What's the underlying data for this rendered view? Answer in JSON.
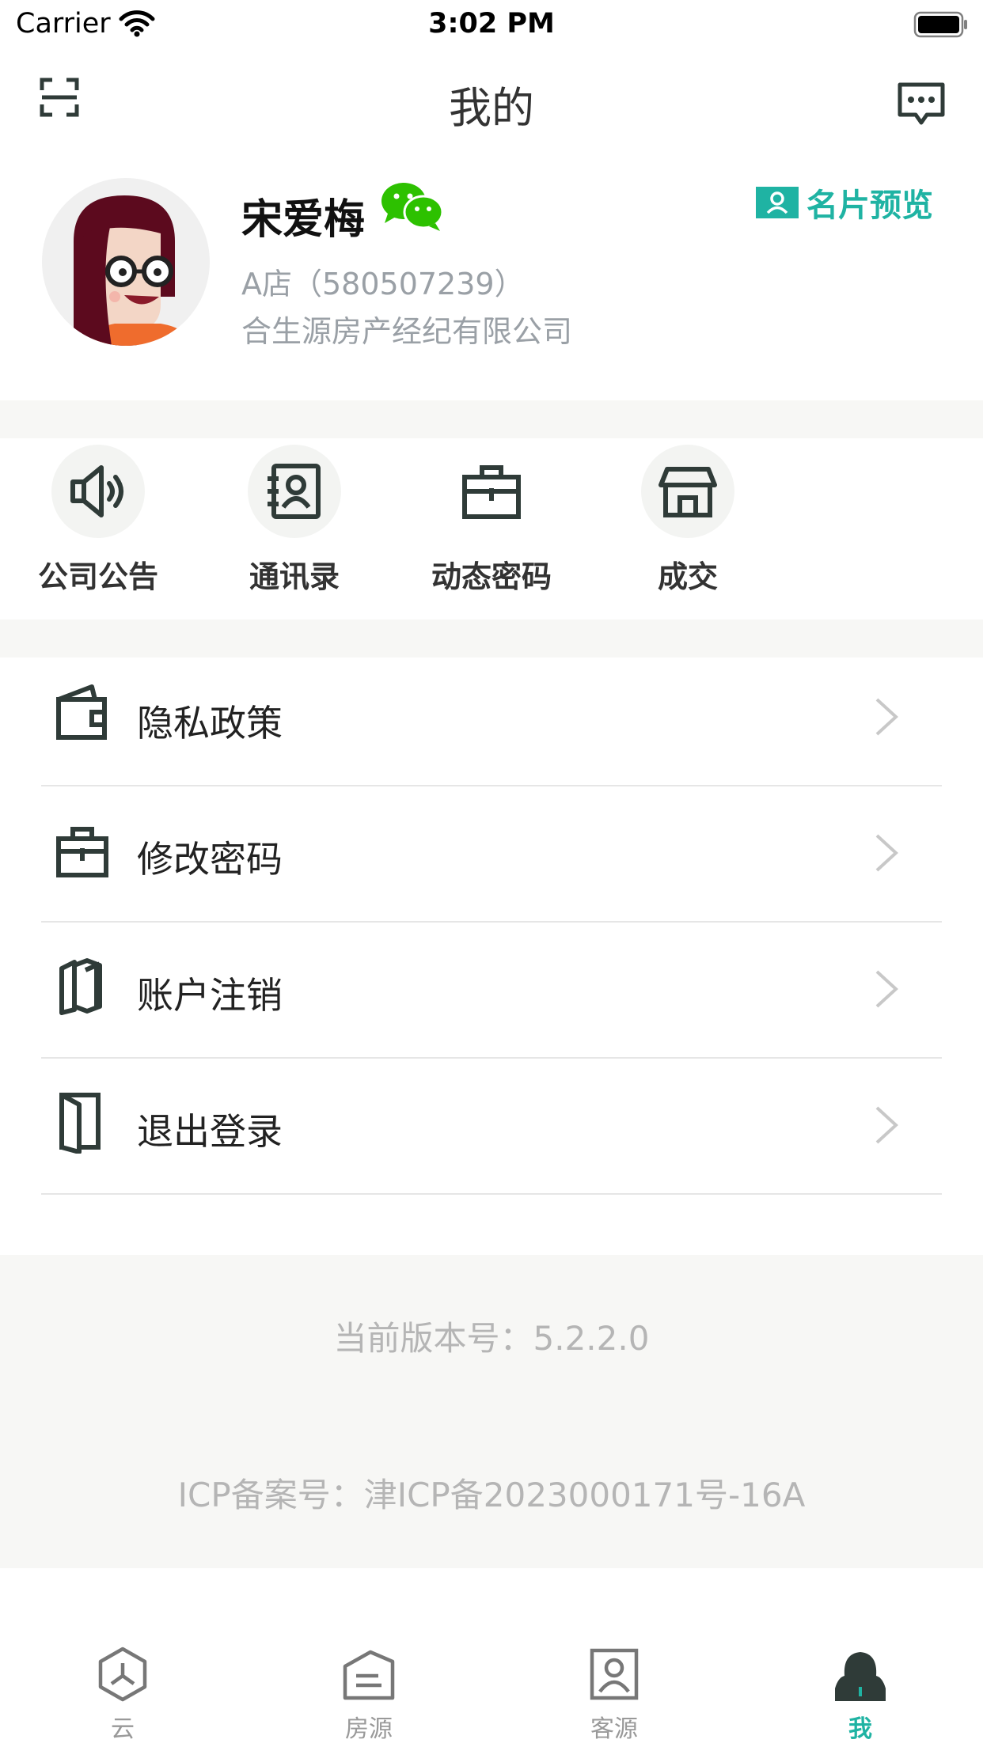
{
  "status_bar": {
    "carrier": "Carrier",
    "time": "3:02 PM"
  },
  "nav": {
    "title": "我的"
  },
  "profile": {
    "name": "宋爱梅",
    "store": "A店（580507239）",
    "company": "合生源房产经纪有限公司",
    "card_preview_label": "名片预览"
  },
  "quick_actions": [
    {
      "label": "公司公告",
      "icon": "speaker-icon"
    },
    {
      "label": "通讯录",
      "icon": "contacts-icon"
    },
    {
      "label": "动态密码",
      "icon": "briefcase-icon"
    },
    {
      "label": "成交",
      "icon": "store-icon"
    }
  ],
  "menu": [
    {
      "label": "隐私政策",
      "icon": "wallet-icon"
    },
    {
      "label": "修改密码",
      "icon": "briefcase-icon"
    },
    {
      "label": "账户注销",
      "icon": "cards-icon"
    },
    {
      "label": "退出登录",
      "icon": "door-icon"
    }
  ],
  "footer": {
    "version": "当前版本号：5.2.2.0",
    "icp": "ICP备案号：津ICP备2023000171号-16A"
  },
  "tabs": [
    {
      "label": "云",
      "icon": "cloud-hex-icon"
    },
    {
      "label": "房源",
      "icon": "house-doc-icon"
    },
    {
      "label": "客源",
      "icon": "client-icon"
    },
    {
      "label": "我",
      "icon": "person-icon",
      "active": true
    }
  ],
  "colors": {
    "accent": "#1fb3a3",
    "icon_dark": "#2f3b38",
    "wechat": "#2dc100",
    "gray_text": "#9aa0a6",
    "section_bg": "#f7f7f5"
  }
}
